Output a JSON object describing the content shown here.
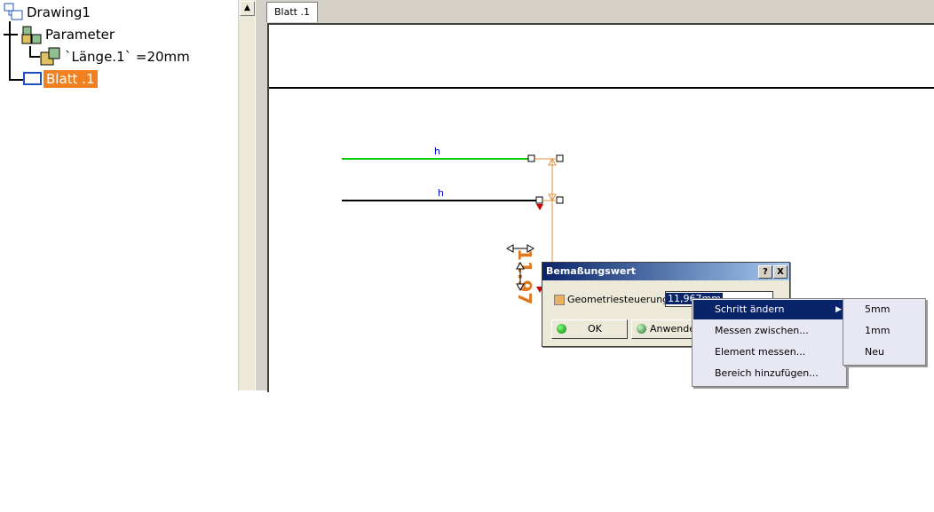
{
  "tree": {
    "root": "Drawing1",
    "parameter": "Parameter",
    "param_value": "`Länge.1` =20mm",
    "sheet": "Blatt .1"
  },
  "tabs": [
    "Blatt .1"
  ],
  "drawing": {
    "line1_label": "h",
    "line2_label": "h",
    "dimension_value": "11.97"
  },
  "dialog": {
    "title": "Bemaßungswert",
    "help": "?",
    "close": "X",
    "checkbox_label": "Geometriesteuerung",
    "value": "11,967mm",
    "ok": "OK",
    "apply": "Anwenden"
  },
  "context_menu": {
    "items": [
      "Schritt ändern",
      "Messen zwischen...",
      "Element messen...",
      "Bereich hinzufügen..."
    ],
    "submenu": [
      "5mm",
      "1mm",
      "Neu"
    ]
  },
  "colors": {
    "highlight": "#f08020",
    "dimension": "#e09040",
    "green_line": "#00cc00",
    "selection": "#0a246a"
  }
}
